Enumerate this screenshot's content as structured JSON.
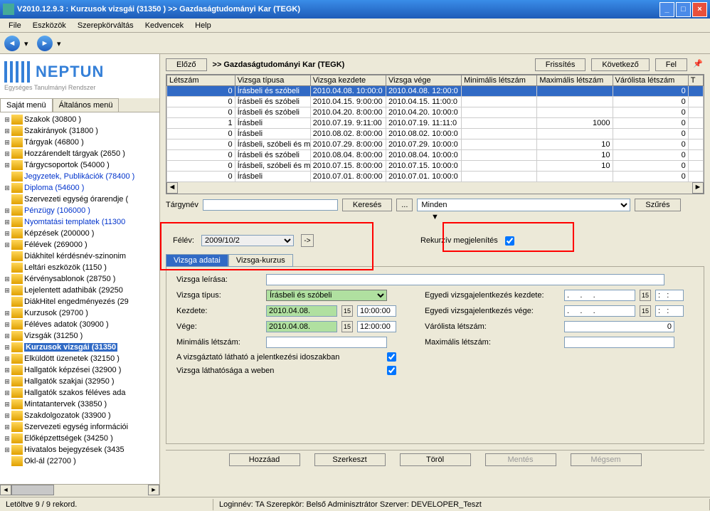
{
  "window": {
    "title": "V2010.12.9.3 : Kurzusok vizsgái (31350 )   >> Gazdaságtudományi Kar (TEGK)"
  },
  "menu": {
    "file": "File",
    "tools": "Eszközök",
    "roles": "Szerepkörváltás",
    "fav": "Kedvencek",
    "help": "Help"
  },
  "logo": {
    "name": "NEPTUN",
    "sub": "Egységes Tanulmányi Rendszer"
  },
  "left_tabs": {
    "own": "Saját menü",
    "general": "Általános menü"
  },
  "tree": [
    {
      "label": "Szakok (30800 )",
      "link": false,
      "exp": "+"
    },
    {
      "label": "Szakirányok (31800 )",
      "link": false,
      "exp": "+"
    },
    {
      "label": "Tárgyak (46800 )",
      "link": false,
      "exp": "+"
    },
    {
      "label": "Hozzárendelt tárgyak (2650 )",
      "link": false,
      "exp": "+"
    },
    {
      "label": "Tárgycsoportok (54000 )",
      "link": false,
      "exp": "+"
    },
    {
      "label": "Jegyzetek, Publikációk (78400 )",
      "link": true,
      "exp": ""
    },
    {
      "label": "Diploma (54600 )",
      "link": true,
      "exp": "+"
    },
    {
      "label": "Szervezeti egység órarendje (",
      "link": false,
      "exp": ""
    },
    {
      "label": "Pénzügy (106000 )",
      "link": true,
      "exp": "+"
    },
    {
      "label": "Nyomtatási templatek (11300",
      "link": true,
      "exp": "+"
    },
    {
      "label": "Képzések (200000 )",
      "link": false,
      "exp": "+"
    },
    {
      "label": "Félévek (269000 )",
      "link": false,
      "exp": "+"
    },
    {
      "label": "Diákhitel kérdésnév-szinonim",
      "link": false,
      "exp": ""
    },
    {
      "label": "Leltári eszközök (1150 )",
      "link": false,
      "exp": ""
    },
    {
      "label": "Kérvénysablonok (28750 )",
      "link": false,
      "exp": "+"
    },
    {
      "label": "Lejelentett adathibák (29250",
      "link": false,
      "exp": "+"
    },
    {
      "label": "DiákHitel engedményezés (29",
      "link": false,
      "exp": ""
    },
    {
      "label": "Kurzusok (29700 )",
      "link": false,
      "exp": "+"
    },
    {
      "label": "Féléves adatok (30900 )",
      "link": false,
      "exp": "+"
    },
    {
      "label": "Vizsgák (31250 )",
      "link": false,
      "exp": "+"
    },
    {
      "label": "Kurzusok vizsgái (31350",
      "link": false,
      "exp": "+",
      "selected": true
    },
    {
      "label": "Elküldött üzenetek (32150 )",
      "link": false,
      "exp": "+"
    },
    {
      "label": "Hallgatók képzései (32900 )",
      "link": false,
      "exp": "+"
    },
    {
      "label": "Hallgatók szakjai (32950 )",
      "link": false,
      "exp": "+"
    },
    {
      "label": "Hallgatók szakos féléves ada",
      "link": false,
      "exp": "+"
    },
    {
      "label": "Mintatantervek (33850 )",
      "link": false,
      "exp": "+"
    },
    {
      "label": "Szakdolgozatok (33900 )",
      "link": false,
      "exp": "+"
    },
    {
      "label": "Szervezeti egység információi",
      "link": false,
      "exp": "+"
    },
    {
      "label": "Előképzettségek (34250 )",
      "link": false,
      "exp": "+"
    },
    {
      "label": "Hivatalos bejegyzések (3435",
      "link": false,
      "exp": "+"
    },
    {
      "label": "Okl-ál (22700 )",
      "link": false,
      "exp": ""
    }
  ],
  "top": {
    "prev": "Előző",
    "breadcrumb": ">>  Gazdaságtudományi Kar (TEGK)",
    "refresh": "Frissítés",
    "next": "Következő",
    "up": "Fel"
  },
  "grid": {
    "headers": [
      "Létszám",
      "Vizsga típusa",
      "Vizsga kezdete",
      "Vizsga vége",
      "Minimális létszám",
      "Maximális létszám",
      "Várólista létszám",
      "T"
    ],
    "rows": [
      {
        "sel": true,
        "cells": [
          "0",
          "Írásbeli és szóbeli",
          "2010.04.08. 10:00:0",
          "2010.04.08. 12:00:0",
          "",
          "",
          "0",
          ""
        ]
      },
      {
        "cells": [
          "0",
          "Írásbeli és szóbeli",
          "2010.04.15. 9:00:00",
          "2010.04.15. 11:00:0",
          "",
          "",
          "0",
          ""
        ]
      },
      {
        "cells": [
          "0",
          "Írásbeli és szóbeli",
          "2010.04.20. 8:00:00",
          "2010.04.20. 10:00:0",
          "",
          "",
          "0",
          ""
        ]
      },
      {
        "cells": [
          "1",
          "Írásbeli",
          "2010.07.19. 9:11:00",
          "2010.07.19. 11:11:0",
          "",
          "1000",
          "0",
          ""
        ]
      },
      {
        "cells": [
          "0",
          "Írásbeli",
          "2010.08.02. 8:00:00",
          "2010.08.02. 10:00:0",
          "",
          "",
          "0",
          ""
        ]
      },
      {
        "cells": [
          "0",
          "Írásbeli, szóbeli és m",
          "2010.07.29. 8:00:00",
          "2010.07.29. 10:00:0",
          "",
          "10",
          "0",
          ""
        ]
      },
      {
        "cells": [
          "0",
          "Írásbeli és szóbeli",
          "2010.08.04. 8:00:00",
          "2010.08.04. 10:00:0",
          "",
          "10",
          "0",
          ""
        ]
      },
      {
        "cells": [
          "0",
          "Írásbeli, szóbeli és m",
          "2010.07.15. 8:00:00",
          "2010.07.15. 10:00:0",
          "",
          "10",
          "0",
          ""
        ]
      },
      {
        "cells": [
          "0",
          "Írásbeli",
          "2010.07.01. 8:00:00",
          "2010.07.01. 10:00:0",
          "",
          "",
          "0",
          ""
        ]
      }
    ]
  },
  "search": {
    "label": "Tárgynév",
    "search": "Keresés",
    "dots": "...",
    "all": "Minden",
    "filter": "Szűrés"
  },
  "filter": {
    "semester_label": "Félév:",
    "semester_value": "2009/10/2",
    "recursive": "Rekurzív megjelenítés"
  },
  "dtabs": {
    "data": "Vizsga adatai",
    "course": "Vizsga-kurzus"
  },
  "form": {
    "desc": "Vizsga leírása:",
    "type": "Vizsga típus:",
    "type_val": "Írásbeli és szóbeli",
    "start": "Kezdete:",
    "start_date": "2010.04.08.",
    "start_time": "10:00:00",
    "end": "Vége:",
    "end_date": "2010.04.08.",
    "end_time": "12:00:00",
    "min": "Minimális létszám:",
    "max": "Maximális létszám:",
    "visible": "A vizsgáztató látható a jelentkezési idoszakban",
    "web": "Vizsga láthatósága a weben",
    "indiv_start": "Egyedi vizsgajelentkezés kezdete:",
    "indiv_end": "Egyedi vizsgajelentkezés vége:",
    "dot_date": ".     .     .",
    "colon_time": ":   :",
    "waitlist": "Várólista létszám:",
    "waitlist_val": "0"
  },
  "bottom": {
    "add": "Hozzáad",
    "edit": "Szerkeszt",
    "del": "Töröl",
    "save": "Mentés",
    "cancel": "Mégsem"
  },
  "status": {
    "count": "Letöltve 9 / 9 rekord.",
    "info": "Loginnév: TA   Szerepkör: Belső Adminisztrátor   Szerver: DEVELOPER_Teszt"
  }
}
